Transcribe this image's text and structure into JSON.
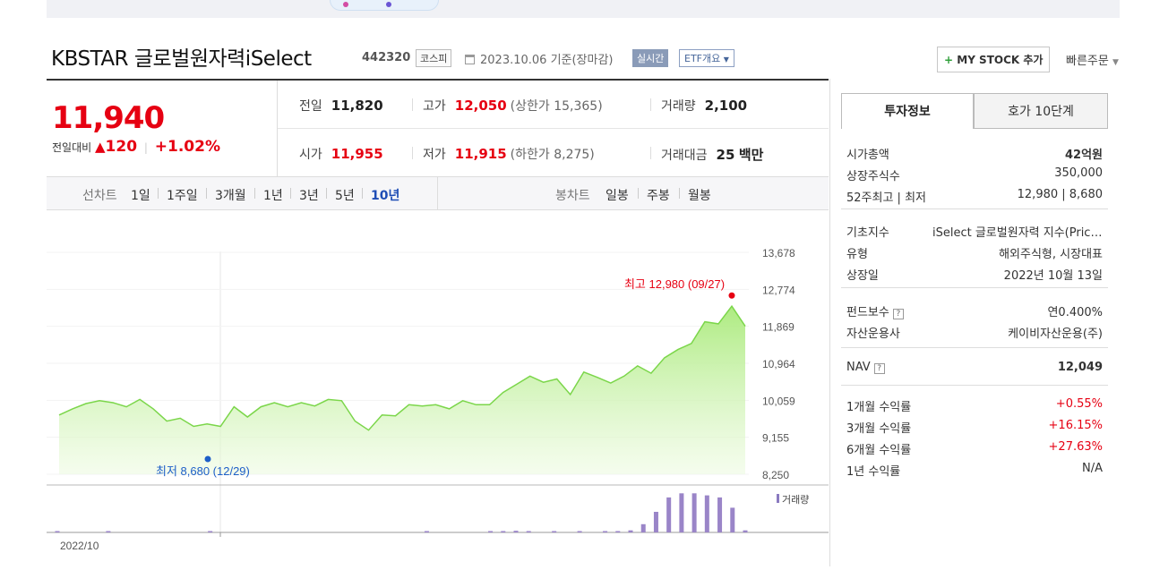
{
  "header": {
    "title": "KBSTAR 글로벌원자력iSelect",
    "code": "442320",
    "market": "코스피",
    "date": "2023.10.06 기준(장마감)",
    "realtime": "실시간",
    "etf": "ETF개요",
    "mystock": "MY STOCK 추가",
    "quick": "빠른주문"
  },
  "price": {
    "current": "11,940",
    "diff_label": "전일대비",
    "change": "120",
    "pct": "+1.02%"
  },
  "stats": {
    "prev_k": "전일",
    "prev_v": "11,820",
    "high_k": "고가",
    "high_v": "12,050",
    "upper": "(상한가 15,365)",
    "vol_k": "거래량",
    "vol_v": "2,100",
    "open_k": "시가",
    "open_v": "11,955",
    "low_k": "저가",
    "low_v": "11,915",
    "lower": "(하한가 8,275)",
    "amt_k": "거래대금",
    "amt_v": "25",
    "amt_unit": "백만"
  },
  "tabs": {
    "line_label": "선차트",
    "line": [
      "1일",
      "1주일",
      "3개월",
      "1년",
      "3년",
      "5년",
      "10년"
    ],
    "candle_label": "봉차트",
    "candle": [
      "일봉",
      "주봉",
      "월봉"
    ]
  },
  "right": {
    "tab1": "투자정보",
    "tab2": "호가 10단계",
    "g1": [
      {
        "k": "시가총액",
        "v": "42억원"
      },
      {
        "k": "상장주식수",
        "v": "350,000"
      },
      {
        "k": "52주최고 | 최저",
        "v": "12,980 | 8,680"
      }
    ],
    "g2": [
      {
        "k": "기초지수",
        "v": "iSelect 글로벌원자력 지수(Price Return)"
      },
      {
        "k": "유형",
        "v": "해외주식형, 시장대표"
      },
      {
        "k": "상장일",
        "v": "2022년 10월 13일"
      }
    ],
    "g3": [
      {
        "k": "펀드보수",
        "v": "연0.400%"
      },
      {
        "k": "자산운용사",
        "v": "케이비자산운용(주)"
      }
    ],
    "nav_k": "NAV",
    "nav_v": "12,049",
    "g5": [
      {
        "k": "1개월 수익률",
        "v": "+0.55%"
      },
      {
        "k": "3개월 수익률",
        "v": "+16.15%"
      },
      {
        "k": "6개월 수익률",
        "v": "+27.63%"
      },
      {
        "k": "1년 수익률",
        "v": "N/A"
      }
    ],
    "help_glyph": "?"
  },
  "chart_data": {
    "type": "area",
    "yticks": [
      "13,678",
      "12,774",
      "11,869",
      "10,964",
      "10,059",
      "9,155",
      "8,250"
    ],
    "ylim": [
      8250,
      13678
    ],
    "x_label_start": "2022/10",
    "max_label": "최고 12,980 (09/27)",
    "min_label": "최저 8,680 (12/29)",
    "volume_label": "거래량",
    "values": [
      9700,
      9850,
      9980,
      10050,
      10000,
      9900,
      10080,
      9850,
      9550,
      9620,
      9420,
      9480,
      9420,
      9900,
      9650,
      9900,
      10000,
      9900,
      10000,
      9920,
      10080,
      10050,
      9550,
      9330,
      9700,
      9680,
      9950,
      9920,
      9950,
      9850,
      10050,
      9950,
      9950,
      10250,
      10450,
      10650,
      10500,
      10580,
      10200,
      10750,
      10620,
      10480,
      10650,
      10900,
      10720,
      11100,
      11300,
      11450,
      11980,
      11930,
      12360,
      11870
    ],
    "volume": [
      0.03,
      0,
      0,
      0,
      0.02,
      0,
      0,
      0,
      0,
      0,
      0,
      0,
      0.02,
      0,
      0,
      0,
      0,
      0,
      0,
      0,
      0,
      0,
      0,
      0,
      0,
      0,
      0,
      0,
      0,
      0.02,
      0,
      0,
      0,
      0,
      0.02,
      0.03,
      0.04,
      0.03,
      0,
      0.02,
      0,
      0.02,
      0,
      0.02,
      0.02,
      0.05,
      0.2,
      0.5,
      0.85,
      0.95,
      0.95,
      0.9,
      0.85,
      0.6,
      0.05
    ]
  }
}
